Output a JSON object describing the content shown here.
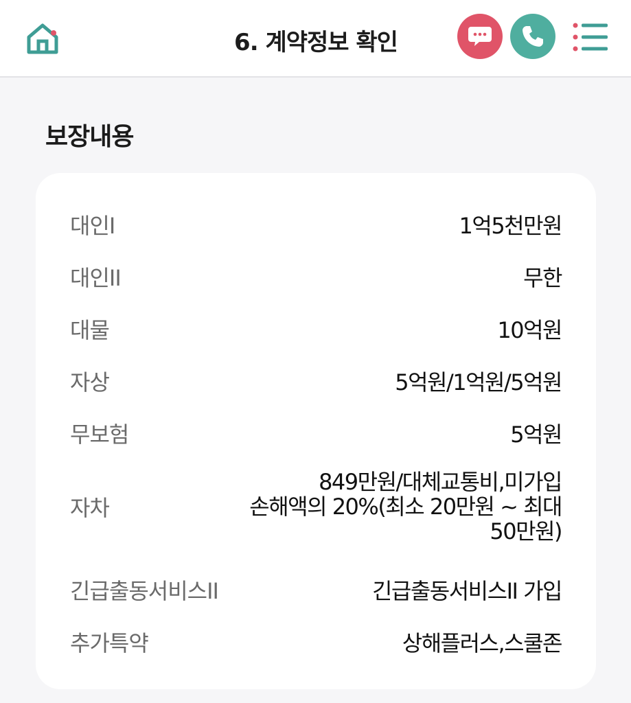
{
  "header": {
    "title": "6. 계약정보 확인",
    "icons": {
      "home": "home-icon",
      "chat": "chat-bubble-icon",
      "call": "phone-icon",
      "menu": "menu-icon"
    },
    "colors": {
      "home": "#3f9d95",
      "chat": "#e05468",
      "call": "#4fae9f",
      "menu_accent": "#e05468",
      "menu_line": "#3f9d95"
    }
  },
  "section": {
    "title": "보장내용"
  },
  "coverage": [
    {
      "label": "대인I",
      "value": "1억5천만원"
    },
    {
      "label": "대인II",
      "value": "무한"
    },
    {
      "label": "대물",
      "value": "10억원"
    },
    {
      "label": "자상",
      "value": "5억원/1억원/5억원"
    },
    {
      "label": "무보험",
      "value": "5억원"
    },
    {
      "label": "자차",
      "value_lines": [
        "849만원/대체교통비,미가입",
        "손해액의 20%(최소 20만원 ~ 최대",
        "50만원)"
      ]
    },
    {
      "label": "긴급출동서비스II",
      "value": "긴급출동서비스II 가입"
    },
    {
      "label": "추가특약",
      "value": "상해플러스,스쿨존"
    }
  ]
}
